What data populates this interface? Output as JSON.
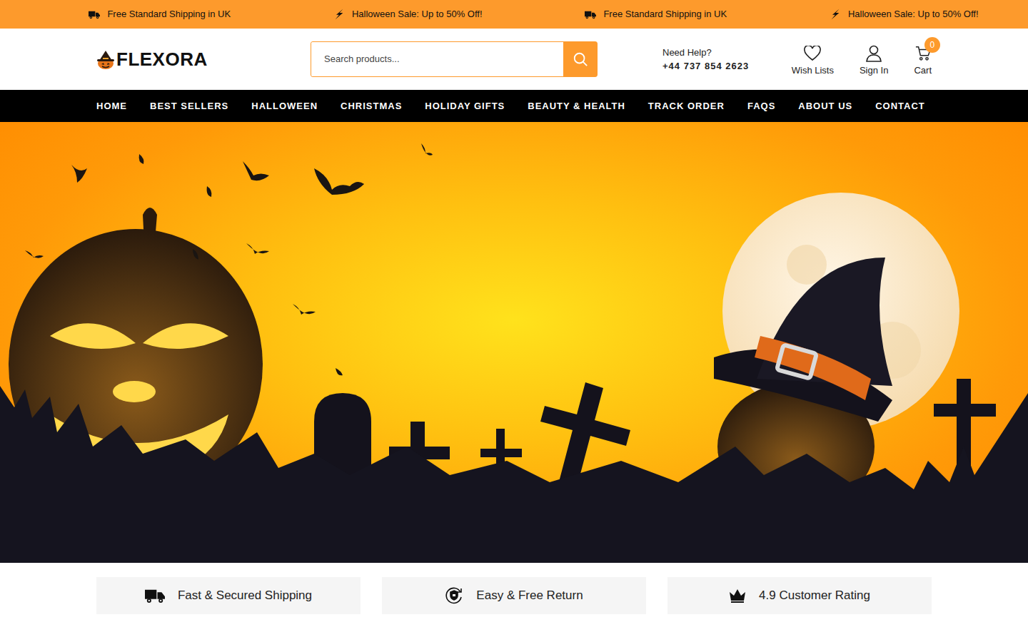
{
  "announcement_bar": {
    "items": [
      {
        "text": "Free Standard Shipping in UK",
        "kind": "shipping"
      },
      {
        "text": "Halloween Sale: Up to 50% Off!",
        "kind": "sale"
      },
      {
        "text": "Free Standard Shipping in UK",
        "kind": "shipping"
      },
      {
        "text": "Halloween Sale: Up to 50% Off!",
        "kind": "sale"
      }
    ]
  },
  "logo": {
    "text": "FLEXORA"
  },
  "search": {
    "placeholder": "Search products..."
  },
  "help": {
    "label": "Need Help?",
    "phone": "+44 737 854 2623"
  },
  "header_actions": [
    {
      "label": "Wish Lists",
      "kind": "wishlist"
    },
    {
      "label": "Sign In",
      "kind": "account"
    },
    {
      "label": "Cart",
      "kind": "cart",
      "badge": "0"
    }
  ],
  "nav": {
    "items": [
      "HOME",
      "BEST SELLERS",
      "HALLOWEEN",
      "CHRISTMAS",
      "HOLIDAY GIFTS",
      "BEAUTY & HEALTH",
      "TRACK ORDER",
      "FAQS",
      "ABOUT US",
      "CONTACT"
    ]
  },
  "features": [
    {
      "text": "Fast & Secured Shipping",
      "kind": "shipping"
    },
    {
      "text": "Easy & Free Return",
      "kind": "return"
    },
    {
      "text": "4.9 Customer Rating",
      "kind": "rating"
    }
  ]
}
